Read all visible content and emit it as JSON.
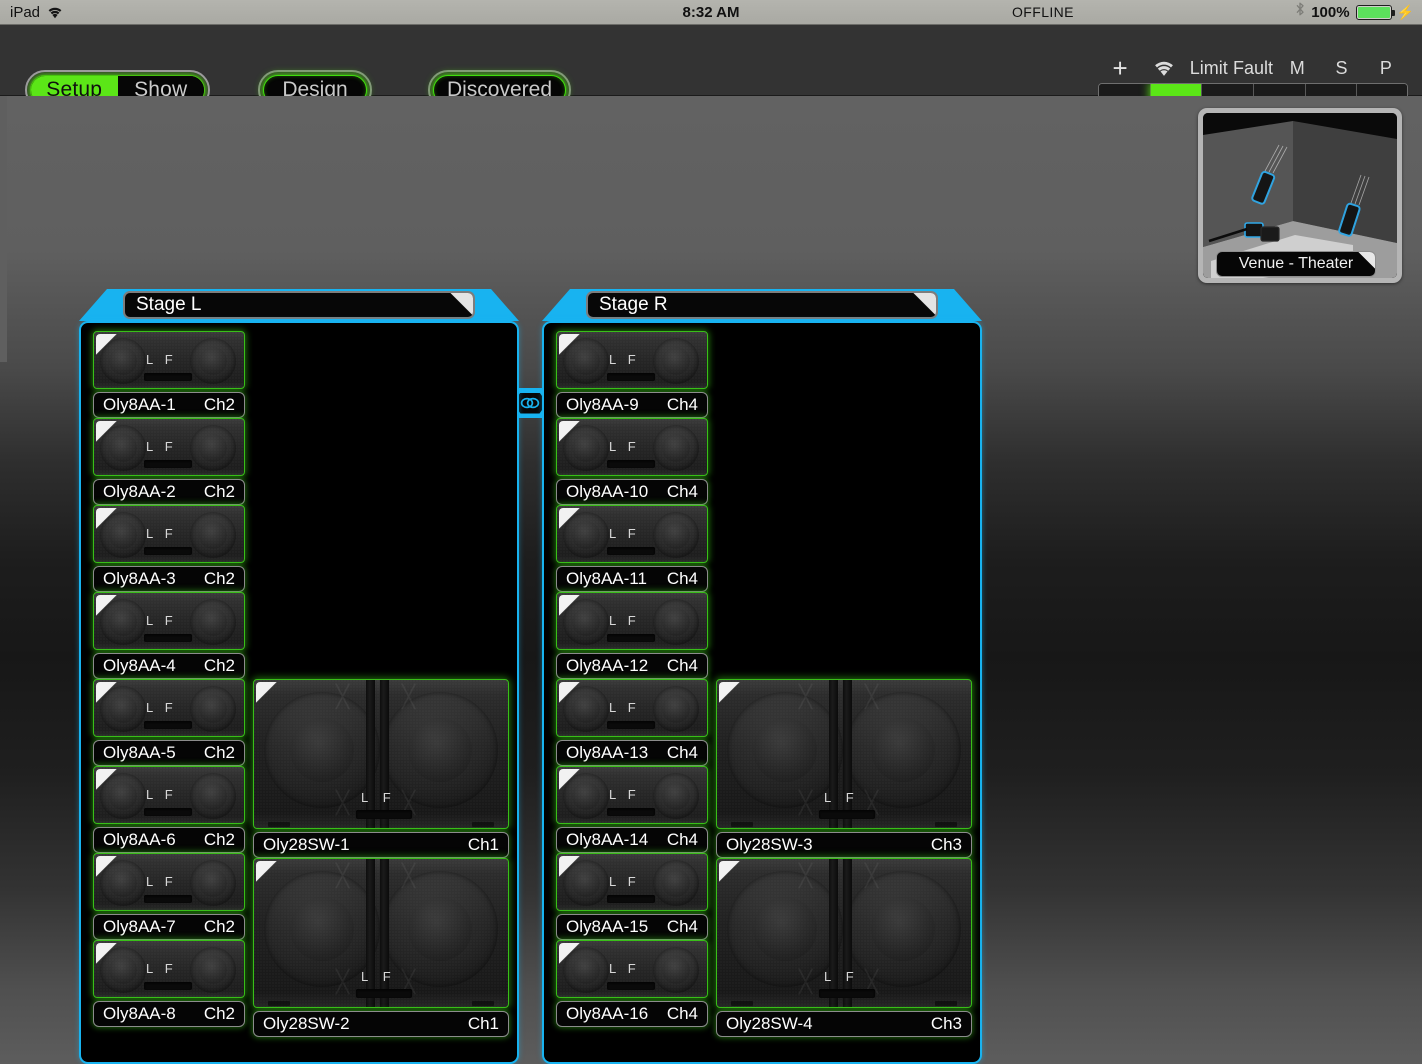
{
  "ios_status": {
    "device": "iPad",
    "wifi_icon": "wifi-icon",
    "time": "8:32 AM",
    "connection": "OFFLINE",
    "bluetooth_icon": "bluetooth-icon",
    "battery_percent": "100%",
    "charging_icon": "lightning-bolt-icon"
  },
  "toolbar": {
    "mode_toggle": {
      "setup_label": "Setup",
      "show_label": "Show",
      "selected": "Setup"
    },
    "design_label": "Design",
    "discovered_label": "Discovered",
    "status": {
      "add_icon": "plus-icon",
      "wifi_icon": "wifi-icon",
      "labels": [
        "Limit",
        "Fault",
        "M",
        "S",
        "P"
      ],
      "cells": [
        {
          "name": "cell-1",
          "lit": false
        },
        {
          "name": "cell-2",
          "lit": true
        },
        {
          "name": "cell-3",
          "lit": false
        },
        {
          "name": "cell-4",
          "lit": false
        },
        {
          "name": "cell-5",
          "lit": false
        },
        {
          "name": "cell-6",
          "lit": false
        }
      ],
      "lit_color": "#5be617"
    }
  },
  "venue": {
    "label": "Venue - Theater",
    "thumbnail_icon": "theater-room-3d-icon"
  },
  "colors": {
    "accent_cyan": "#18b3f0",
    "accent_green": "#5be617",
    "cabinet_outline_green": "#39bf18",
    "panel_black": "#000000"
  },
  "link_badge": {
    "icon": "link-rings-icon"
  },
  "groups": [
    {
      "name": "Stage L",
      "line_array": [
        {
          "label": "Oly8AA-1",
          "channel": "Ch2"
        },
        {
          "label": "Oly8AA-2",
          "channel": "Ch2"
        },
        {
          "label": "Oly8AA-3",
          "channel": "Ch2"
        },
        {
          "label": "Oly8AA-4",
          "channel": "Ch2"
        },
        {
          "label": "Oly8AA-5",
          "channel": "Ch2"
        },
        {
          "label": "Oly8AA-6",
          "channel": "Ch2"
        },
        {
          "label": "Oly8AA-7",
          "channel": "Ch2"
        },
        {
          "label": "Oly8AA-8",
          "channel": "Ch2"
        }
      ],
      "subs": [
        {
          "label": "Oly28SW-1",
          "channel": "Ch1"
        },
        {
          "label": "Oly28SW-2",
          "channel": "Ch1"
        }
      ]
    },
    {
      "name": "Stage R",
      "line_array": [
        {
          "label": "Oly8AA-9",
          "channel": "Ch4"
        },
        {
          "label": "Oly8AA-10",
          "channel": "Ch4"
        },
        {
          "label": "Oly8AA-11",
          "channel": "Ch4"
        },
        {
          "label": "Oly8AA-12",
          "channel": "Ch4"
        },
        {
          "label": "Oly8AA-13",
          "channel": "Ch4"
        },
        {
          "label": "Oly8AA-14",
          "channel": "Ch4"
        },
        {
          "label": "Oly8AA-15",
          "channel": "Ch4"
        },
        {
          "label": "Oly8AA-16",
          "channel": "Ch4"
        }
      ],
      "subs": [
        {
          "label": "Oly28SW-3",
          "channel": "Ch3"
        },
        {
          "label": "Oly28SW-4",
          "channel": "Ch3"
        }
      ]
    }
  ],
  "cabinet_marks": {
    "left_label": "L",
    "right_label": "F"
  }
}
